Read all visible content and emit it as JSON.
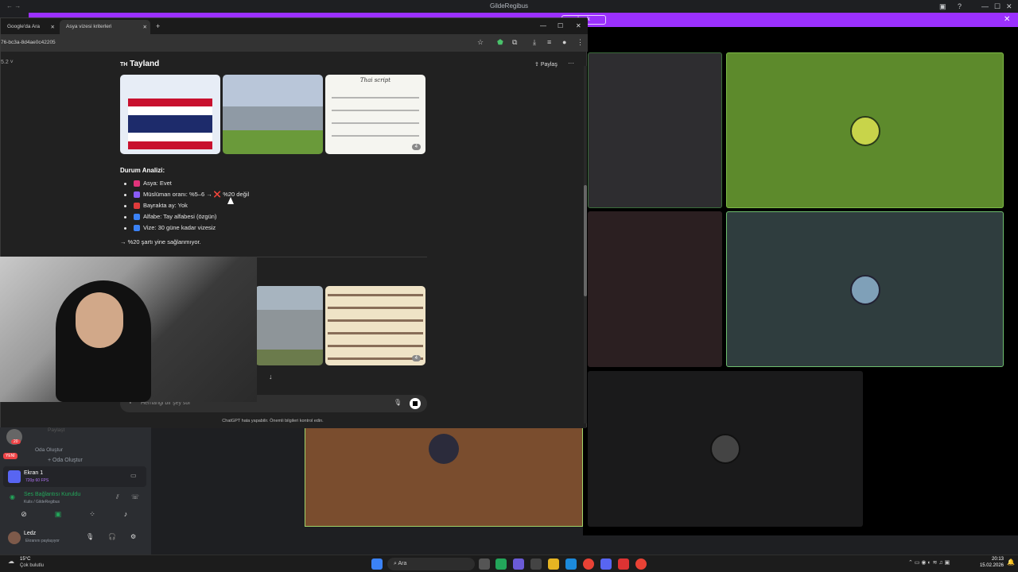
{
  "discord": {
    "window_title": "GildeRegibus",
    "banner_button": "bırak",
    "banner_close": "✕",
    "room_create_1": "Oda Oluştur",
    "room_create_2": "Oda Oluştur",
    "faded_item": "Paylaşt",
    "new_badge": "YENİ",
    "count_badge": "20",
    "screen_title": "Ekran 1",
    "screen_sub": "720p 60 FPS",
    "voice_status": "Ses Bağlantısı Kuruldu",
    "voice_sub": "Kulis / GildeRegibus",
    "user_name": "Ledz",
    "user_status": "Ekranını paylaşıyor"
  },
  "browser": {
    "tabs": [
      {
        "label": "Google'da Ara"
      },
      {
        "label": "Asya vizesi kriterleri"
      }
    ],
    "new_tab": "+",
    "url": "76-bc3a-8d4ae0c42205",
    "version": "5.2 ˅"
  },
  "chat": {
    "country_code": "TH",
    "country_name": "Tayland",
    "share_label": "Paylaş",
    "more": "···",
    "image_caption_thai": "Thai script",
    "image_count_1": "4",
    "image_count_2": "4",
    "section_title": "Durum Analizi:",
    "bullets": [
      {
        "text": "Asya: Evet",
        "color": "#e0337a"
      },
      {
        "text": "Müslüman oranı: %5–6 → ❌ %20 değil",
        "color": "#8a5cf6"
      },
      {
        "text": "Bayrakta ay: Yok",
        "color": "#e03b3b"
      },
      {
        "text": "Alfabe: Tay alfabesi (özgün)",
        "color": "#3b82f6"
      },
      {
        "text": "Vize: 30 güne kadar vizesiz",
        "color": "#3b82f6"
      }
    ],
    "conclusion": "→ %20 şartı yine sağlanmıyor.",
    "input_placeholder": "Herhangi bir şey sor",
    "disclaimer": "ChatGPT hata yapabilir. Önemli bilgileri kontrol edin."
  },
  "taskbar": {
    "weather_temp": "15°C",
    "weather_desc": "Çok bulutlu",
    "search_label": "Ara",
    "time": "20:13",
    "date": "15.02.2026"
  },
  "colors": {
    "banner": "#9b30ff",
    "tile_green": "#5d8a2c",
    "tile_slate": "#2f3d3e",
    "tile_brown": "#7a4d2e"
  }
}
